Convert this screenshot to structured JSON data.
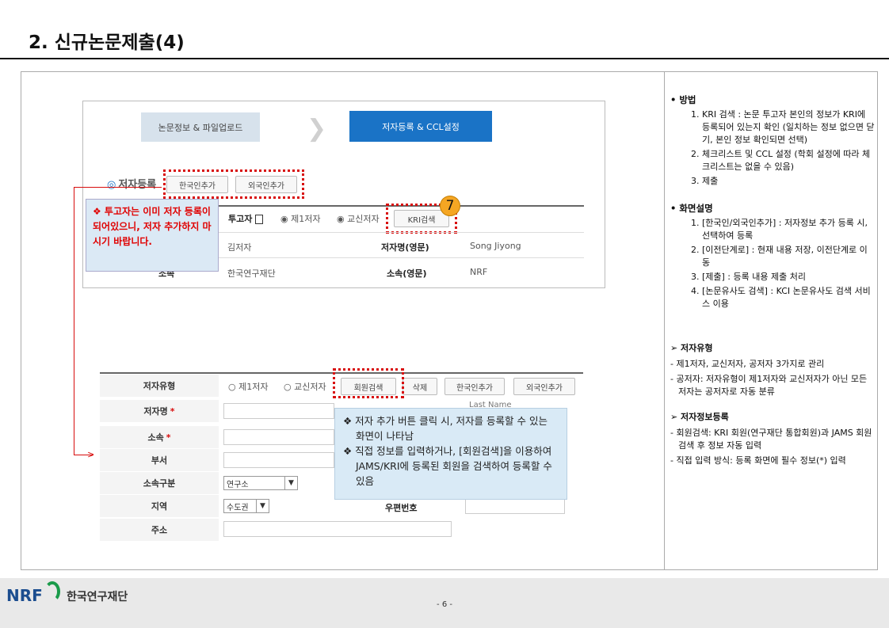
{
  "page": {
    "title": "2. 신규논문제출(4)",
    "page_number": "- 6 -",
    "org_name": "한국연구재단",
    "logo_text": "NRF"
  },
  "shot1": {
    "step1": "논문정보 & 파일업로드",
    "step2": "저자등록 & CCL설정",
    "section": "저자등록",
    "btn_korean": "한국인추가",
    "btn_foreign": "외국인추가",
    "submitter_label": "투고자",
    "radio_first": "제1저자",
    "radio_corr": "교신저자",
    "btn_kri": "KRI검색",
    "name_ko": "김저자",
    "name_en_label": "저자명(영문)",
    "name_en": "Song Jiyong",
    "affil_partial": "소속",
    "affil_ko": "한국연구재단",
    "affil_en_label": "소속(영문)",
    "affil_en": "NRF"
  },
  "red_note": "❖  투고자는 이미 저자 등록이 되어있으니, 저자 추가하지 마시기 바랍니다.",
  "badge": "7",
  "shot2": {
    "author_type_label": "저자유형",
    "radio_first": "제1저자",
    "radio_corr": "교신저자",
    "btn_member": "회원검색",
    "btn_delete": "삭제",
    "btn_korean": "한국인추가",
    "btn_foreign": "외국인추가",
    "name_label": "저자명",
    "last_name_placeholder": "Last Name",
    "affil_label": "소속",
    "dept_label": "부서",
    "affil_type_label": "소속구분",
    "affil_type_value": "연구소",
    "region_label": "지역",
    "region_value": "수도권",
    "postal_label": "우편번호",
    "address_label": "주소",
    "required_mark": "*"
  },
  "blue_note": {
    "line1": "❖ 저자 추가 버튼 클릭 시, 저자를 등록할 수 있는 화면이 나타남",
    "line2": "❖ 직접 정보를 입력하거나, [회원검색]을 이용하여 JAMS/KRI에 등록된 회원을 검색하여 등록할 수 있음"
  },
  "right_panel": {
    "method_head": "• 방법",
    "method_1": "1. KRI 검색 : 논문 투고자 본인의 정보가 KRI에 등록되어 있는지 확인 (일치하는 정보 없으면 닫기, 본인 정보 확인되면 선택)",
    "method_2": "2. 체크리스트 및 CCL 설정 (학회 설정에 따라 체크리스트는 없을 수 있음)",
    "method_3": "3. 제출",
    "screen_head": "• 화면설명",
    "screen_1": "1. [한국인/외국인추가] : 저자정보 추가 등록 시, 선택하여 등록",
    "screen_2": "2. [이전단계로] : 현재 내용 저장, 이전단계로 이동",
    "screen_3": "3. [제출] : 등록 내용 제출 처리",
    "screen_4": "4. [논문유사도 검색] : KCI 논문유사도 검색 서비스 이용",
    "type_head": "➢  저자유형",
    "type_1": "- 제1저자, 교신저자, 공저자 3가지로 관리",
    "type_2": "- 공저자: 저자유형이 제1저자와 교신저자가 아닌 모든 저자는 공저자로 자동 분류",
    "info_head": "➢  저자정보등록",
    "info_1": "- 회원검색: KRI 회원(연구재단 통합회원)과 JAMS 회원 검색 후 정보 자동 입력",
    "info_2": "- 직접 입력 방식: 등록 화면에 필수 정보(*) 입력"
  }
}
